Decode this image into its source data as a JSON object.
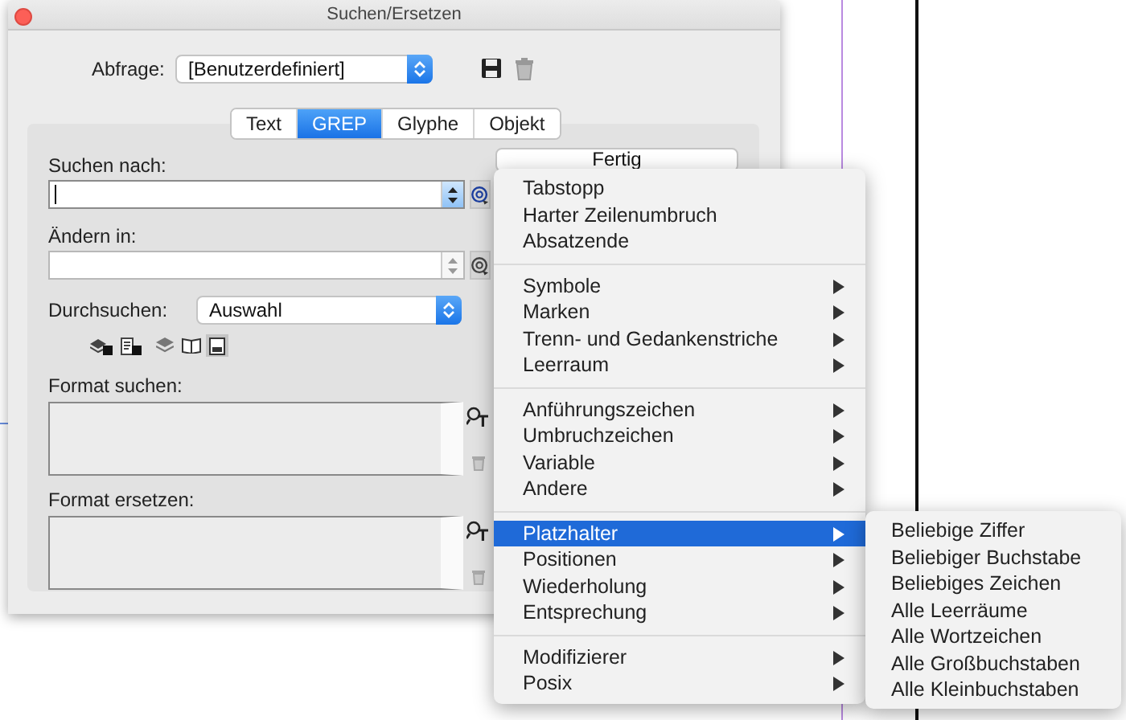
{
  "window": {
    "title": "Suchen/Ersetzen"
  },
  "query": {
    "label": "Abfrage:",
    "value": "[Benutzerdefiniert]"
  },
  "tabs": [
    {
      "label": "Text",
      "selected": false
    },
    {
      "label": "GREP",
      "selected": true
    },
    {
      "label": "Glyphe",
      "selected": false
    },
    {
      "label": "Objekt",
      "selected": false
    }
  ],
  "fields": [
    {
      "label": "Suchen nach:",
      "focused": true
    },
    {
      "label": "Ändern in:",
      "focused": false
    }
  ],
  "search_in": {
    "label": "Durchsuchen:",
    "value": "Auswahl"
  },
  "options": [
    {
      "kind": "locked-layers",
      "selected": false
    },
    {
      "kind": "locked-document",
      "selected": false
    },
    {
      "kind": "stack",
      "selected": false
    },
    {
      "kind": "book",
      "selected": false
    },
    {
      "kind": "page",
      "selected": true
    }
  ],
  "format_boxes": [
    {
      "label": "Format suchen:"
    },
    {
      "label": "Format ersetzen:"
    }
  ],
  "done_button": "Fertig",
  "menu": {
    "groups": [
      [
        {
          "label": "Tabstopp",
          "submenu": false,
          "selected": false
        },
        {
          "label": "Harter Zeilenumbruch",
          "submenu": false,
          "selected": false
        },
        {
          "label": "Absatzende",
          "submenu": false,
          "selected": false
        }
      ],
      [
        {
          "label": "Symbole",
          "submenu": true,
          "selected": false
        },
        {
          "label": "Marken",
          "submenu": true,
          "selected": false
        },
        {
          "label": "Trenn- und Gedankenstriche",
          "submenu": true,
          "selected": false
        },
        {
          "label": "Leerraum",
          "submenu": true,
          "selected": false
        }
      ],
      [
        {
          "label": "Anführungszeichen",
          "submenu": true,
          "selected": false
        },
        {
          "label": "Umbruchzeichen",
          "submenu": true,
          "selected": false
        },
        {
          "label": "Variable",
          "submenu": true,
          "selected": false
        },
        {
          "label": "Andere",
          "submenu": true,
          "selected": false
        }
      ],
      [
        {
          "label": "Platzhalter",
          "submenu": true,
          "selected": true
        },
        {
          "label": "Positionen",
          "submenu": true,
          "selected": false
        },
        {
          "label": "Wiederholung",
          "submenu": true,
          "selected": false
        },
        {
          "label": "Entsprechung",
          "submenu": true,
          "selected": false
        }
      ],
      [
        {
          "label": "Modifizierer",
          "submenu": true,
          "selected": false
        },
        {
          "label": "Posix",
          "submenu": true,
          "selected": false
        }
      ]
    ]
  },
  "submenu": {
    "items": [
      "Beliebige Ziffer",
      "Beliebiger Buchstabe",
      "Beliebiges Zeichen",
      "Alle Leerräume",
      "Alle Wortzeichen",
      "Alle Großbuchstaben",
      "Alle Kleinbuchstaben"
    ]
  }
}
